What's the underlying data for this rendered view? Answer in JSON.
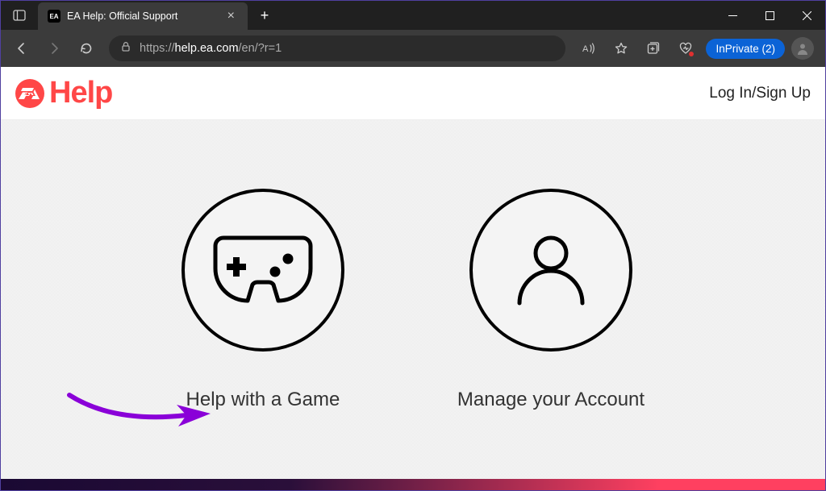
{
  "browser": {
    "tab": {
      "title": "EA Help: Official Support",
      "favicon": "EA"
    },
    "url": {
      "scheme": "https://",
      "host": "help.ea.com",
      "path": "/en/?r=1"
    },
    "inprivate_label": "InPrivate (2)"
  },
  "site": {
    "logo_text": "Help",
    "login_text": "Log In/Sign Up"
  },
  "options": {
    "game": "Help with a Game",
    "account": "Manage your Account"
  }
}
